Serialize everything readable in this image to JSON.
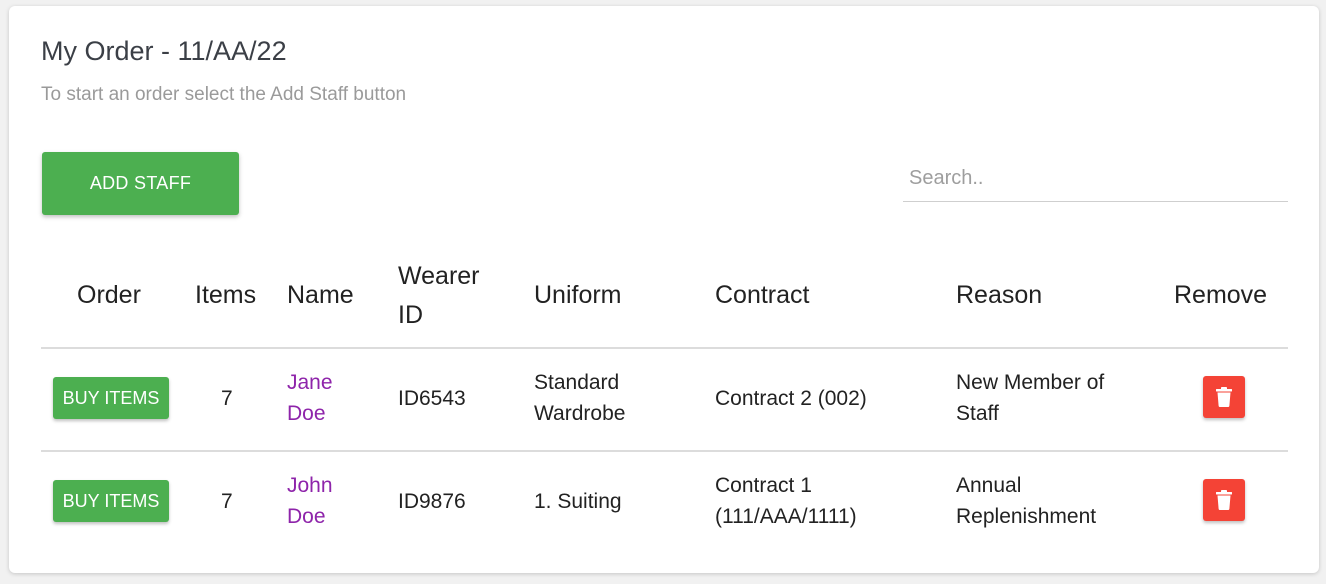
{
  "order": {
    "title": "My Order - 11/AA/22",
    "subtitle": "To start an order select the Add Staff button"
  },
  "toolbar": {
    "add_staff_label": "ADD STAFF",
    "search_placeholder": "Search.."
  },
  "table": {
    "headers": {
      "order": "Order",
      "items": "Items",
      "name": "Name",
      "wearer_id_line1": "Wearer",
      "wearer_id_line2": "ID",
      "uniform": "Uniform",
      "contract": "Contract",
      "reason": "Reason",
      "remove": "Remove"
    },
    "rows": [
      {
        "buy_label": "BUY ITEMS",
        "items": "7",
        "name_first": "Jane",
        "name_last": "Doe",
        "wearer_id": "ID6543",
        "uniform_line1": "Standard",
        "uniform_line2": "Wardrobe",
        "contract_line1": "Contract 2 (002)",
        "contract_line2": "",
        "reason_line1": "New Member of",
        "reason_line2": "Staff",
        "remove_icon": "trash-icon"
      },
      {
        "buy_label": "BUY ITEMS",
        "items": "7",
        "name_first": "John",
        "name_last": "Doe",
        "wearer_id": "ID9876",
        "uniform_line1": "1. Suiting",
        "uniform_line2": "",
        "contract_line1": "Contract 1",
        "contract_line2": "(111/AAA/1111)",
        "reason_line1": "Annual",
        "reason_line2": "Replenishment",
        "remove_icon": "trash-icon"
      }
    ]
  },
  "colors": {
    "primary_green": "#4caf50",
    "danger_red": "#f44336",
    "link_purple": "#8e24aa"
  }
}
